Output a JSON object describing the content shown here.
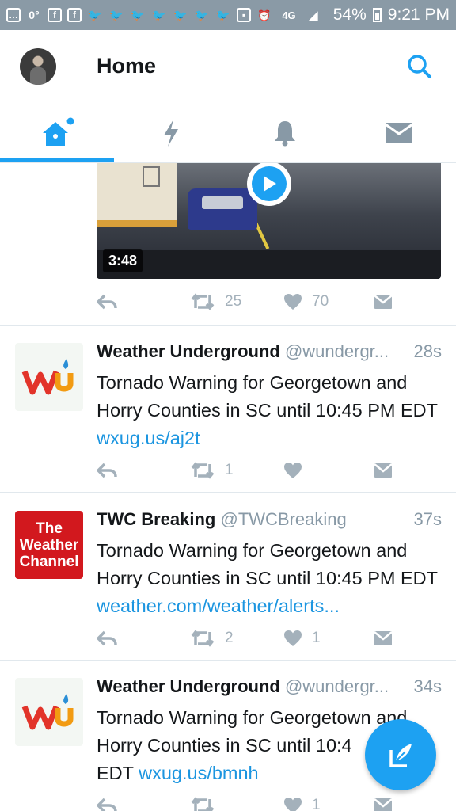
{
  "status_bar": {
    "temp": "0°",
    "network": "4G",
    "battery": "54%",
    "time": "9:21 PM",
    "icons": [
      "chat-icon",
      "flipboard-icon",
      "flipboard-icon",
      "twitter-icon",
      "twitter-icon",
      "twitter-icon",
      "twitter-icon",
      "twitter-icon",
      "twitter-icon",
      "twitter-icon",
      "sim-icon",
      "alarm-icon",
      "signal-icon",
      "battery-icon"
    ]
  },
  "header": {
    "title": "Home"
  },
  "tabs": [
    {
      "name": "home",
      "icon": "home-icon",
      "active": true
    },
    {
      "name": "moments",
      "icon": "lightning-icon"
    },
    {
      "name": "notifications",
      "icon": "bell-icon"
    },
    {
      "name": "messages",
      "icon": "envelope-icon"
    }
  ],
  "video_tweet": {
    "duration": "3:48",
    "retweets": "25",
    "likes": "70"
  },
  "tweets": [
    {
      "name": "Weather Underground",
      "handle": "@wundergr...",
      "time": "28s",
      "text": "Tornado Warning for Georgetown and Horry Counties in SC until 10:45 PM EDT ",
      "link": "wxug.us/aj2t",
      "retweets": "1",
      "likes": "",
      "logo": "wu"
    },
    {
      "name": "TWC Breaking",
      "handle": "@TWCBreaking",
      "time": "37s",
      "text": "Tornado Warning for Georgetown and Horry Counties in SC until 10:45 PM EDT ",
      "link": "weather.com/weather/alerts...",
      "retweets": "2",
      "likes": "1",
      "logo": "twc",
      "logo_text": [
        "The",
        "Weather",
        "Channel"
      ]
    },
    {
      "name": "Weather Underground",
      "handle": "@wundergr...",
      "time": "34s",
      "text": "Tornado Warning for Georgetown and Horry Counties in SC until 10:4",
      "text_end": "EDT ",
      "link": "wxug.us/bmnh",
      "retweets": "",
      "likes": "1",
      "logo": "wu"
    }
  ],
  "colors": {
    "accent": "#1da1f2",
    "link": "#1b95e0",
    "status_bar": "#8a9aa6",
    "action_gray": "#a4b1bb"
  }
}
